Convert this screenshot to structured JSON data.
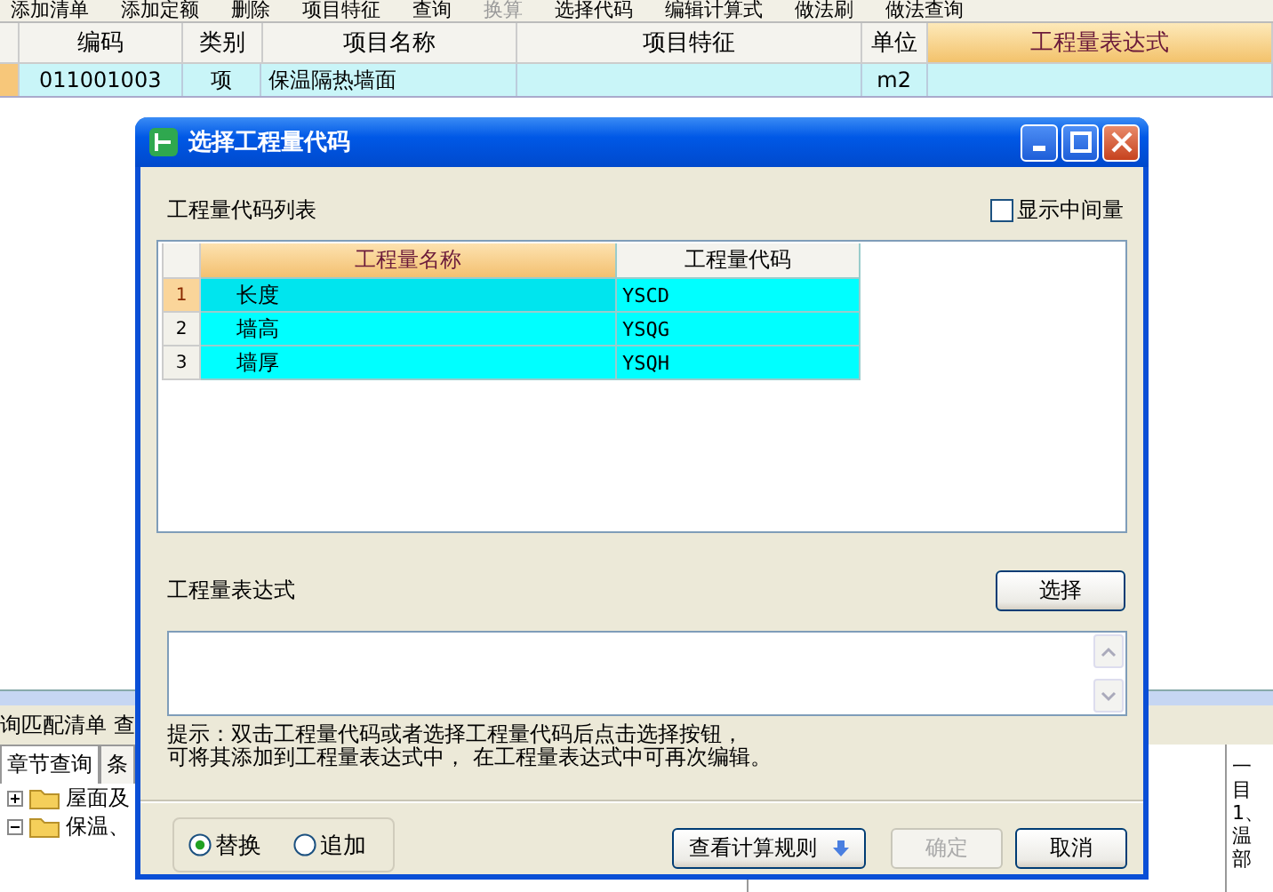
{
  "toolbar": [
    {
      "label": "添加清单",
      "disabled": false
    },
    {
      "label": "添加定额",
      "disabled": false
    },
    {
      "label": "删除",
      "disabled": false
    },
    {
      "label": "项目特征",
      "disabled": false
    },
    {
      "label": "查询",
      "disabled": false
    },
    {
      "label": "换算",
      "disabled": true
    },
    {
      "label": "选择代码",
      "disabled": false
    },
    {
      "label": "编辑计算式",
      "disabled": false
    },
    {
      "label": "做法刷",
      "disabled": false
    },
    {
      "label": "做法查询",
      "disabled": false
    }
  ],
  "table": {
    "columns": [
      {
        "label": "编码",
        "selected": false
      },
      {
        "label": "类别",
        "selected": false
      },
      {
        "label": "项目名称",
        "selected": false
      },
      {
        "label": "项目特征",
        "selected": false
      },
      {
        "label": "单位",
        "selected": false
      },
      {
        "label": "工程量表达式",
        "selected": true
      }
    ],
    "rows": [
      {
        "code": "011001003",
        "type": "项",
        "name": "保温隔热墙面",
        "unit": "m2"
      }
    ]
  },
  "lower_pane": {
    "title_line": [
      "询匹配清单",
      "查"
    ],
    "tabs": [
      {
        "label": "章节查询",
        "selected": true
      },
      {
        "label": "条",
        "selected": false
      }
    ],
    "tree": [
      {
        "label": "屋面及",
        "expanded": false
      },
      {
        "label": "保温、",
        "expanded": true
      }
    ],
    "side_text": [
      "一",
      "目",
      "1、",
      "温",
      "部"
    ]
  },
  "dialog": {
    "title": "选择工程量代码",
    "list_label": "工程量代码列表",
    "show_intermediate": {
      "label": "显示中间量",
      "checked": false
    },
    "grid": {
      "columns": [
        "工程量名称",
        "工程量代码"
      ],
      "rows": [
        {
          "index": "1",
          "name": "长度",
          "code": "YSCD",
          "selected": true
        },
        {
          "index": "2",
          "name": "墙高",
          "code": "YSQG",
          "selected": false
        },
        {
          "index": "3",
          "name": "墙厚",
          "code": "YSQH",
          "selected": false
        }
      ]
    },
    "expression_label": "工程量表达式",
    "select_button": "选择",
    "hint": [
      "提示：双击工程量代码或者选择工程量代码后点击选择按钮，",
      "可将其添加到工程量表达式中， 在工程量表达式中可再次编辑。"
    ],
    "modes": [
      {
        "label": "替换",
        "selected": true
      },
      {
        "label": "追加",
        "selected": false
      }
    ],
    "buttons": [
      {
        "label": "查看计算规则",
        "kind": "dropdown",
        "disabled": false
      },
      {
        "label": "确定",
        "kind": "plain",
        "disabled": true
      },
      {
        "label": "取消",
        "kind": "plain",
        "disabled": false
      }
    ]
  }
}
